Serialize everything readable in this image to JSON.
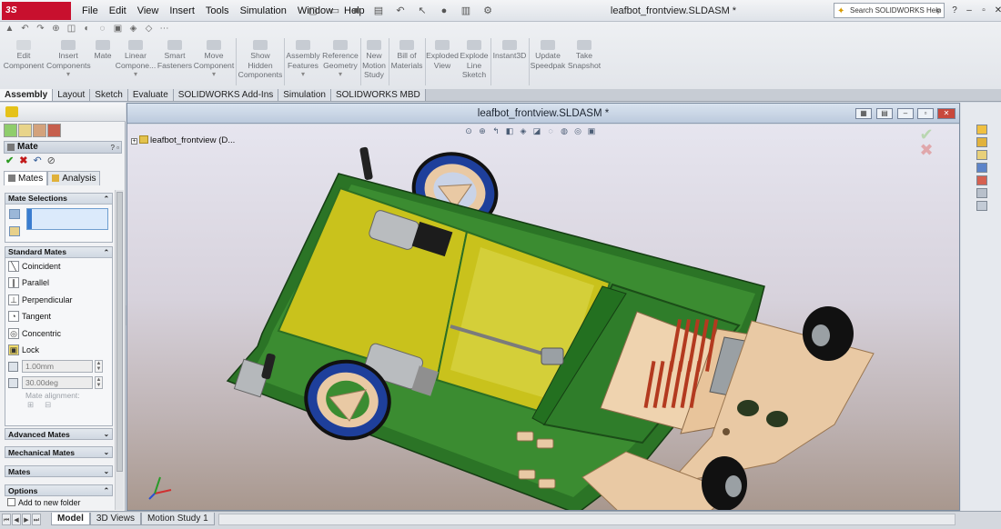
{
  "app": {
    "logo_text": "3S SOLIDWORKS",
    "menu": [
      "File",
      "Edit",
      "View",
      "Insert",
      "Tools",
      "Simulation",
      "Window",
      "Help"
    ],
    "document_title": "leafbot_frontview.SLDASM *",
    "search_placeholder": "Search SOLIDWORKS Help",
    "accent_color": "#c8102e"
  },
  "ribbon": {
    "commands": [
      {
        "label_lines": [
          "Edit",
          "Component"
        ],
        "icon": "edit-component-icon",
        "enabled": false
      },
      {
        "label_lines": [
          "Insert",
          "Components"
        ],
        "icon": "insert-components-icon",
        "enabled": true,
        "dropdown": true
      },
      {
        "label_lines": [
          "Mate"
        ],
        "icon": "mate-icon",
        "enabled": true
      },
      {
        "label_lines": [
          "Linear",
          "Compone..."
        ],
        "icon": "linear-pattern-icon",
        "enabled": true,
        "dropdown": true
      },
      {
        "label_lines": [
          "Smart",
          "Fasteners"
        ],
        "icon": "smart-fasteners-icon",
        "enabled": true
      },
      {
        "label_lines": [
          "Move",
          "Component"
        ],
        "icon": "move-component-icon",
        "enabled": true,
        "dropdown": true
      },
      {
        "label_lines": [
          "Show",
          "Hidden",
          "Components"
        ],
        "icon": "show-hidden-icon",
        "enabled": true
      },
      {
        "label_lines": [
          "Assembly",
          "Features"
        ],
        "icon": "assembly-features-icon",
        "enabled": true,
        "dropdown": true
      },
      {
        "label_lines": [
          "Reference",
          "Geometry"
        ],
        "icon": "reference-geometry-icon",
        "enabled": true,
        "dropdown": true
      },
      {
        "label_lines": [
          "New",
          "Motion",
          "Study"
        ],
        "icon": "motion-study-icon",
        "enabled": true
      },
      {
        "label_lines": [
          "Bill of",
          "Materials"
        ],
        "icon": "bom-icon",
        "enabled": true
      },
      {
        "label_lines": [
          "Exploded",
          "View"
        ],
        "icon": "exploded-view-icon",
        "enabled": true
      },
      {
        "label_lines": [
          "Explode",
          "Line",
          "Sketch"
        ],
        "icon": "explode-line-icon",
        "enabled": true
      },
      {
        "label_lines": [
          "Instant3D"
        ],
        "icon": "instant3d-icon",
        "enabled": true
      },
      {
        "label_lines": [
          "Update",
          "Speedpak"
        ],
        "icon": "speedpak-icon",
        "enabled": true
      },
      {
        "label_lines": [
          "Take",
          "Snapshot"
        ],
        "icon": "snapshot-icon",
        "enabled": true
      }
    ]
  },
  "tabs": [
    "Assembly",
    "Layout",
    "Sketch",
    "Evaluate",
    "SOLIDWORKS Add-Ins",
    "Simulation",
    "SOLIDWORKS MBD"
  ],
  "active_tab": "Assembly",
  "property_manager": {
    "title": "Mate",
    "help_label": "?",
    "pm_tabs": [
      "Mates",
      "Analysis"
    ],
    "active_pm_tab": "Mates",
    "sections": {
      "mate_selections": "Mate Selections",
      "standard_mates": "Standard Mates",
      "advanced_mates": "Advanced Mates",
      "mechanical_mates": "Mechanical Mates",
      "mates": "Mates",
      "options": "Options"
    },
    "standard_mates": [
      {
        "label": "Coincident",
        "icon": "coincident-icon"
      },
      {
        "label": "Parallel",
        "icon": "parallel-icon"
      },
      {
        "label": "Perpendicular",
        "icon": "perpendicular-icon"
      },
      {
        "label": "Tangent",
        "icon": "tangent-icon"
      },
      {
        "label": "Concentric",
        "icon": "concentric-icon"
      },
      {
        "label": "Lock",
        "icon": "lock-icon"
      }
    ],
    "distance_value": "1.00mm",
    "angle_value": "30.00deg",
    "mate_alignment_label": "Mate alignment:",
    "options_checkbox": "Add to new folder"
  },
  "viewport": {
    "title": "leafbot_frontview.SLDASM *",
    "tree_root": "leafbot_frontview  (D...",
    "colors": {
      "chassis": "#2f7d2a",
      "plate": "#c9c21c",
      "wood": "#e9c9a4",
      "wheel": "#1e3f9b",
      "tire": "#111111"
    }
  },
  "bottom_tabs": [
    "Model",
    "3D Views",
    "Motion Study 1"
  ],
  "active_bottom_tab": "Model"
}
